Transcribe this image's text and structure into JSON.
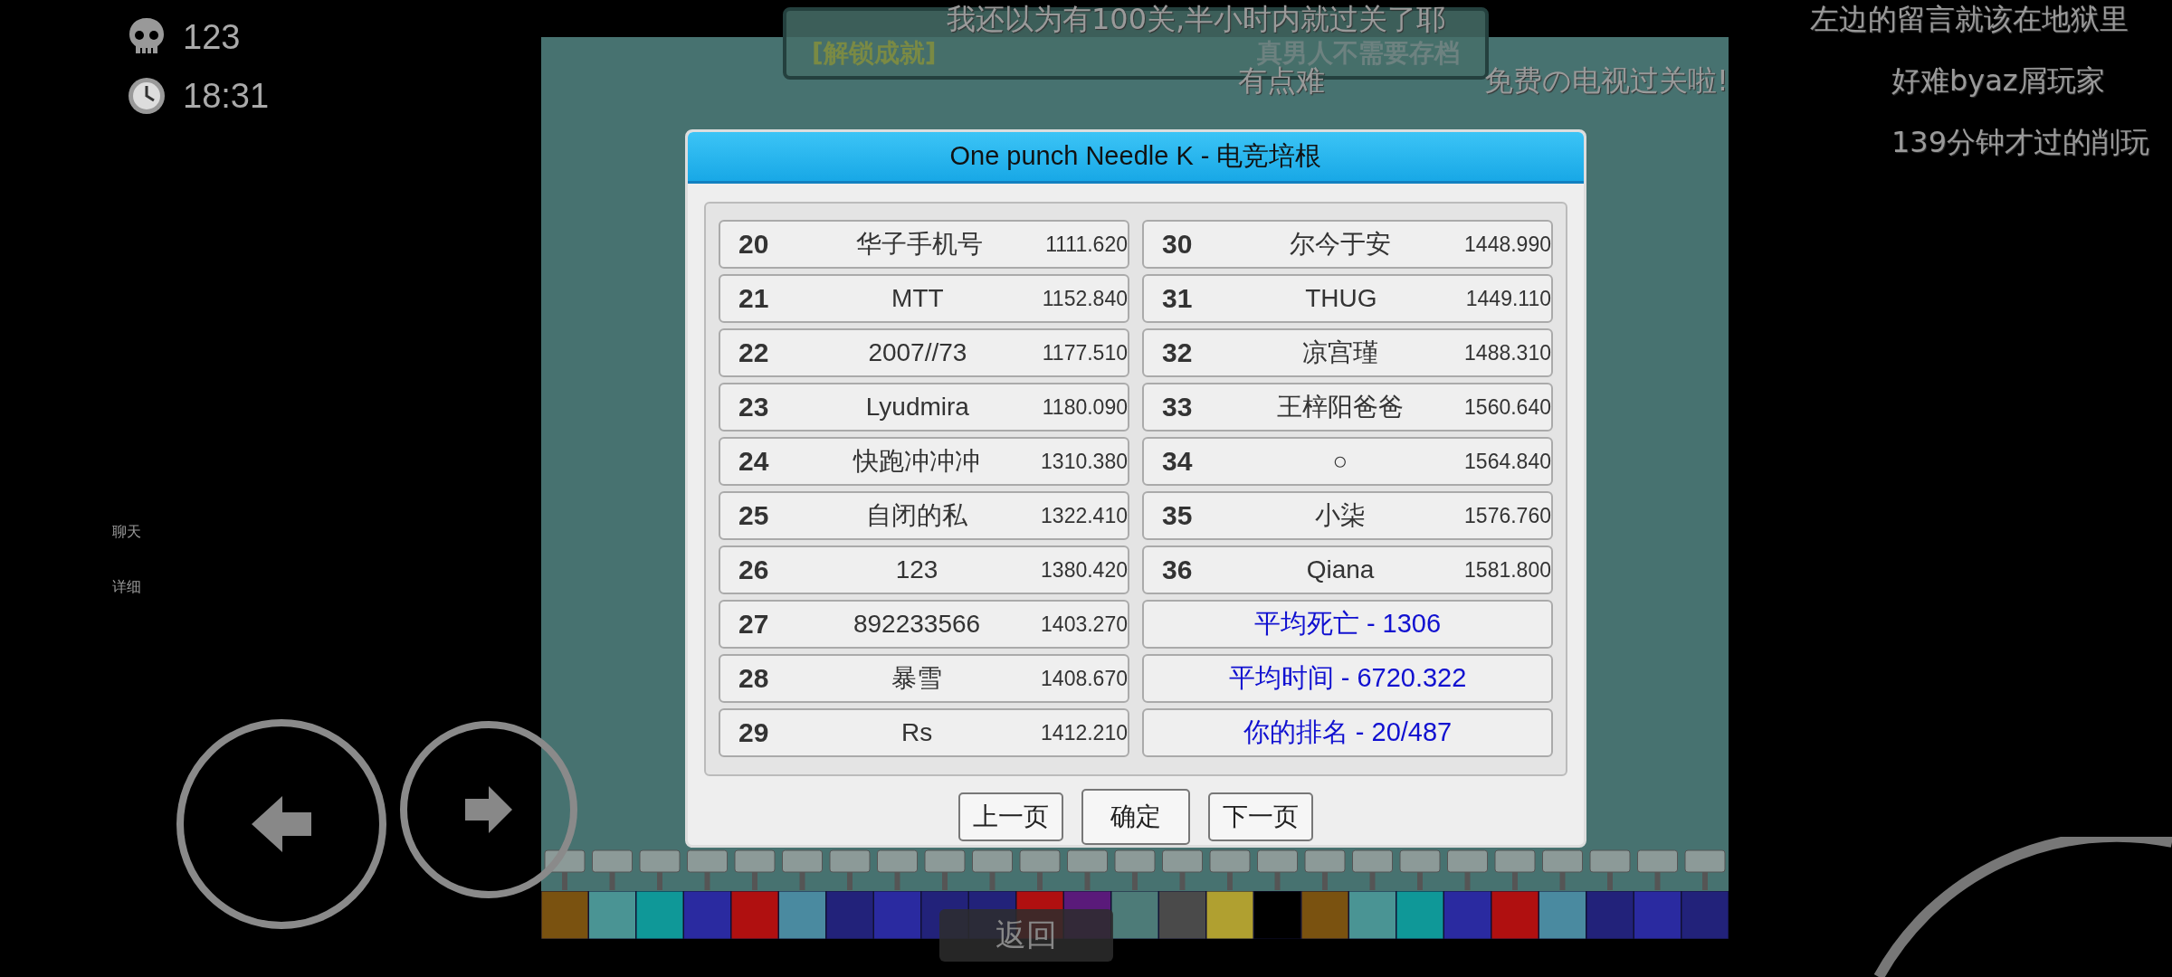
{
  "hud": {
    "deaths": "123",
    "time": "18:31"
  },
  "side_buttons": [
    "聊天",
    "详细"
  ],
  "achievement": {
    "tag": "[解锁成就]",
    "name": "真男人不需要存档"
  },
  "danmaku": [
    "我还以为有100关,半小时内就过关了耶",
    "有点难",
    "免费の电视过关啦!",
    "左边的留言就该在地狱里",
    "好难byaz屑玩家",
    "139分钟才过的削玩"
  ],
  "dialog": {
    "title": "One punch Needle K - 电竞培根",
    "entries": [
      {
        "rank": "20",
        "name": "华子手机号",
        "time": "1111.620"
      },
      {
        "rank": "21",
        "name": "MTT",
        "time": "1152.840"
      },
      {
        "rank": "22",
        "name": "2007//73",
        "time": "1177.510"
      },
      {
        "rank": "23",
        "name": "Lyudmira",
        "time": "1180.090"
      },
      {
        "rank": "24",
        "name": "快跑冲冲冲",
        "time": "1310.380"
      },
      {
        "rank": "25",
        "name": "自闭的私",
        "time": "1322.410"
      },
      {
        "rank": "26",
        "name": "123",
        "time": "1380.420"
      },
      {
        "rank": "27",
        "name": "892233566",
        "time": "1403.270"
      },
      {
        "rank": "28",
        "name": "暴雪",
        "time": "1408.670"
      },
      {
        "rank": "29",
        "name": "Rs",
        "time": "1412.210"
      },
      {
        "rank": "30",
        "name": "尔今于安",
        "time": "1448.990"
      },
      {
        "rank": "31",
        "name": "THUG",
        "time": "1449.110"
      },
      {
        "rank": "32",
        "name": "凉宫瑾",
        "time": "1488.310"
      },
      {
        "rank": "33",
        "name": "王梓阳爸爸",
        "time": "1560.640"
      },
      {
        "rank": "34",
        "name": "○",
        "time": "1564.840"
      },
      {
        "rank": "35",
        "name": "小柒",
        "time": "1576.760"
      },
      {
        "rank": "36",
        "name": "Qiana",
        "time": "1581.800"
      }
    ],
    "stats": [
      "平均死亡 - 1306",
      "平均时间 - 6720.322",
      "你的排名 - 20/487"
    ],
    "buttons": [
      "上一页",
      "确定",
      "下一页"
    ]
  },
  "back_button": "返回"
}
